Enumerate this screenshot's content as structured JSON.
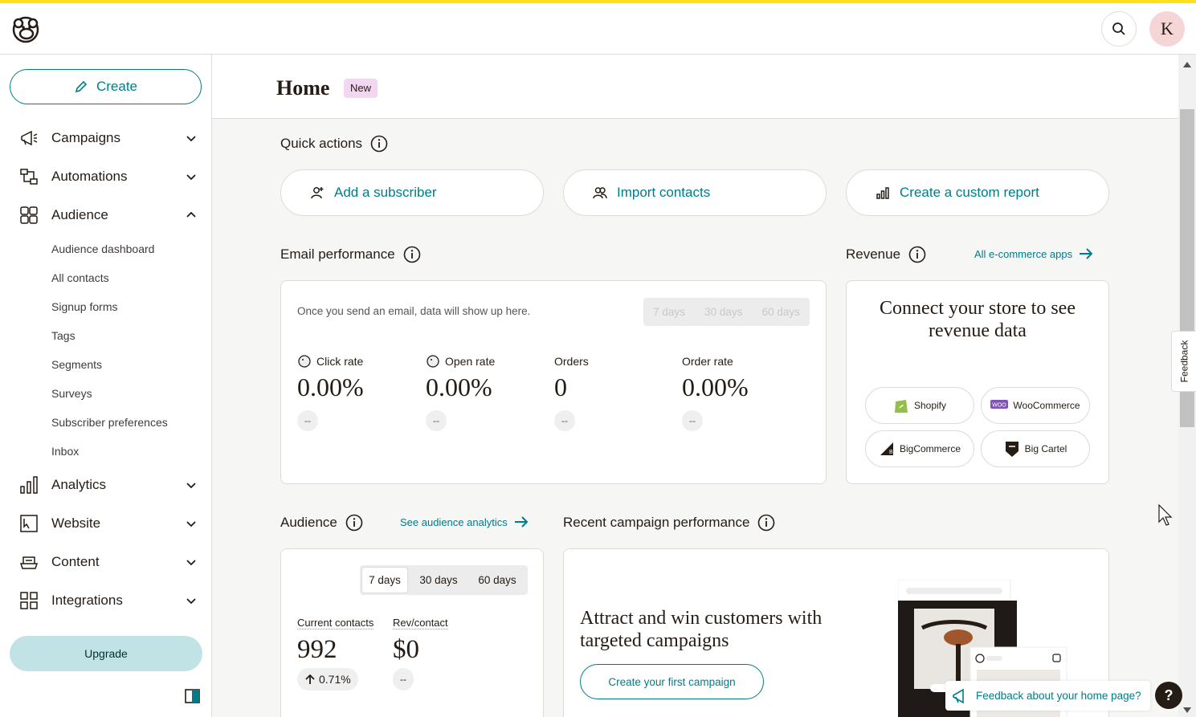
{
  "app": {
    "accent_color": "#007c89",
    "brand_stripe_color": "#ffe01b"
  },
  "topbar": {
    "avatar_initial": "K",
    "search_icon": "search-icon",
    "logo_icon": "mailchimp-logo-icon"
  },
  "sidebar": {
    "create_label": "Create",
    "items": [
      {
        "label": "Campaigns",
        "icon": "megaphone-icon",
        "expanded": false
      },
      {
        "label": "Automations",
        "icon": "automations-icon",
        "expanded": false
      },
      {
        "label": "Audience",
        "icon": "audience-icon",
        "expanded": true
      },
      {
        "label": "Analytics",
        "icon": "bar-chart-icon",
        "expanded": false
      },
      {
        "label": "Website",
        "icon": "website-icon",
        "expanded": false
      },
      {
        "label": "Content",
        "icon": "content-icon",
        "expanded": false
      },
      {
        "label": "Integrations",
        "icon": "grid-icon",
        "expanded": false
      }
    ],
    "audience_subitems": [
      "Audience dashboard",
      "All contacts",
      "Signup forms",
      "Tags",
      "Segments",
      "Surveys",
      "Subscriber preferences",
      "Inbox"
    ],
    "upgrade_label": "Upgrade"
  },
  "page": {
    "title": "Home",
    "badge": "New"
  },
  "quick_actions": {
    "title": "Quick actions",
    "buttons": [
      "Add a subscriber",
      "Import contacts",
      "Create a custom report"
    ]
  },
  "email_performance": {
    "title": "Email performance",
    "note": "Once you send an email, data will show up here.",
    "ranges": [
      "7 days",
      "30 days",
      "60 days"
    ],
    "metrics": [
      {
        "label": "Click rate",
        "value": "0.00%",
        "change": "--"
      },
      {
        "label": "Open rate",
        "value": "0.00%",
        "change": "--"
      },
      {
        "label": "Orders",
        "value": "0",
        "change": "--"
      },
      {
        "label": "Order rate",
        "value": "0.00%",
        "change": "--"
      }
    ]
  },
  "revenue": {
    "title": "Revenue",
    "link": "All e-commerce apps",
    "heading": "Connect your store to see revenue data",
    "stores": [
      "Shopify",
      "WooCommerce",
      "BigCommerce",
      "Big Cartel"
    ]
  },
  "audience": {
    "title": "Audience",
    "link": "See audience analytics",
    "ranges": [
      "7 days",
      "30 days",
      "60 days"
    ],
    "selected_range": "7 days",
    "current_contacts_label": "Current contacts",
    "current_contacts_value": "992",
    "current_contacts_change": "0.71%",
    "rev_contact_label": "Rev/contact",
    "rev_contact_value": "$0",
    "rev_contact_change": "--"
  },
  "recent_campaign": {
    "title": "Recent campaign performance",
    "heading": "Attract and win customers with targeted campaigns",
    "button": "Create your first campaign"
  },
  "feedback": {
    "tab_label": "Feedback",
    "pill_label": "Feedback about your home page?",
    "help_label": "?"
  }
}
